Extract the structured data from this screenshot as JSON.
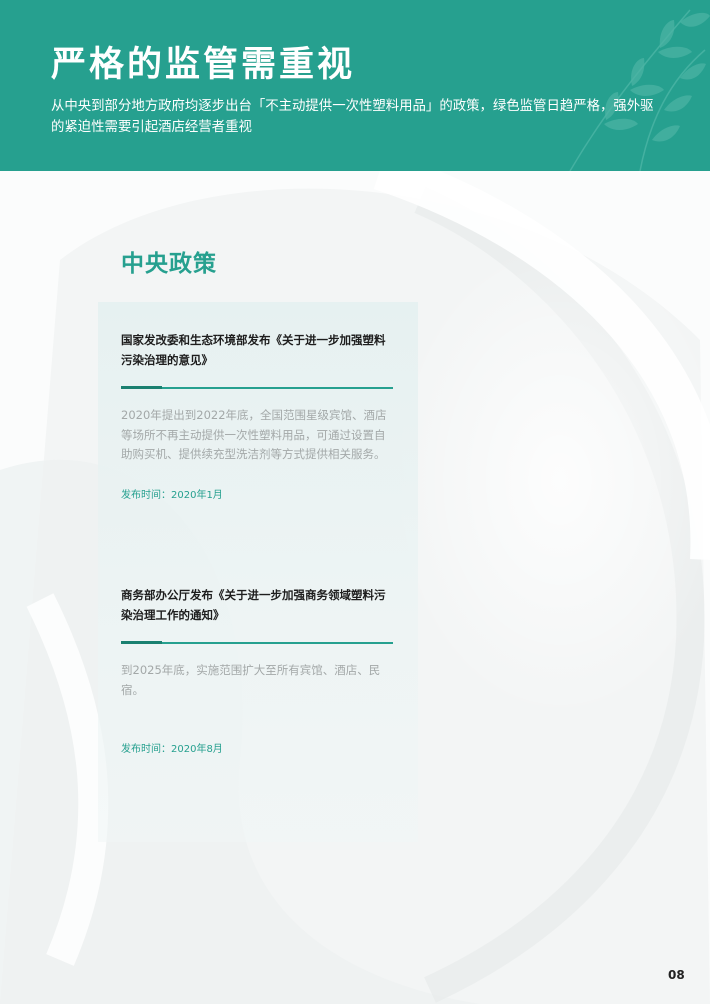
{
  "header": {
    "title": "严格的监管需重视",
    "subtitle": "从中央到部分地方政府均逐步出台「不主动提供一次性塑料用品」的政策，绿色监管日趋严格，强外驱的紧迫性需要引起酒店经营者重视"
  },
  "section": {
    "heading": "中央政策"
  },
  "policies": [
    {
      "title": "国家发改委和生态环境部发布《关于进一步加强塑料污染治理的意见》",
      "body": "2020年提出到2022年底，全国范围星级宾馆、酒店等场所不再主动提供一次性塑料用品，可通过设置自助购买机、提供续充型洗洁剂等方式提供相关服务。",
      "date": "发布时间：2020年1月"
    },
    {
      "title": "商务部办公厅发布《关于进一步加强商务领域塑料污染治理工作的通知》",
      "body": "到2025年底，实施范围扩大至所有宾馆、酒店、民宿。",
      "date": "发布时间：2020年8月"
    }
  ],
  "page_number": "08",
  "colors": {
    "brand_teal": "#26a08f",
    "dark_teal": "#1a8070",
    "body_gray": "#a3a8a8"
  },
  "icons": {
    "header_decoration": "leaf-branch-icon"
  }
}
